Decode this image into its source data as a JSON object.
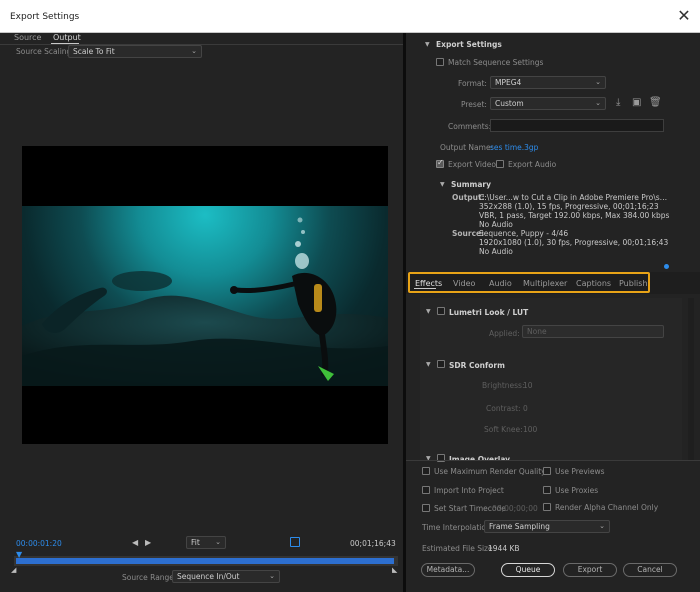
{
  "window": {
    "title": "Export Settings",
    "close_label": "✕"
  },
  "left": {
    "tabs": [
      "Source",
      "Output"
    ],
    "active_tab": "Output",
    "source_scaling_label": "Source Scaling:",
    "source_scaling_value": "Scale To Fit",
    "timecode_start": "00:00:01:20",
    "timecode_end": "00;01;16;43",
    "fit_value": "Fit",
    "source_range_label": "Source Range:",
    "source_range_value": "Sequence In/Out"
  },
  "export": {
    "header": "Export Settings",
    "match_sequence_label": "Match Sequence Settings",
    "format_label": "Format:",
    "format_value": "MPEG4",
    "preset_label": "Preset:",
    "preset_value": "Custom",
    "comments_label": "Comments:",
    "output_name_label": "Output Name:",
    "output_name_value": "ses time.3gp",
    "export_video_label": "Export Video",
    "export_audio_label": "Export Audio",
    "summary_header": "Summary",
    "output_label": "Output:",
    "output_lines": [
      "C:\\User...w to Cut a Clip in Adobe Premiere Pro\\ses time.3gp",
      "352x288 (1.0), 15 fps, Progressive, 00;01;16;23",
      "VBR, 1 pass, Target 192.00 kbps, Max 384.00 kbps",
      "No Audio"
    ],
    "source_label": "Source:",
    "source_lines": [
      "Sequence, Puppy - 4/46",
      "1920x1080 (1.0), 30 fps, Progressive, 00;01;16;43",
      "No Audio"
    ]
  },
  "tabs": {
    "items": [
      "Effects",
      "Video",
      "Audio",
      "Multiplexer",
      "Captions",
      "Publish"
    ],
    "active": "Effects",
    "highlight_color": "#e8a317"
  },
  "effects": {
    "lumetri_header": "Lumetri Look / LUT",
    "applied_label": "Applied:",
    "applied_value": "None",
    "sdr_header": "SDR Conform",
    "brightness_label": "Brightness:",
    "brightness_value": "10",
    "contrast_label": "Contrast:",
    "contrast_value": "0",
    "soft_knee_label": "Soft Knee:",
    "soft_knee_value": "100",
    "image_overlay_header": "Image Overlay"
  },
  "bottom": {
    "max_render_label": "Use Maximum Render Quality",
    "use_previews_label": "Use Previews",
    "import_project_label": "Import Into Project",
    "use_proxies_label": "Use Proxies",
    "set_start_tc_label": "Set Start Timecode",
    "start_tc_value": "00;00;00;00",
    "render_alpha_label": "Render Alpha Channel Only",
    "time_interp_label": "Time Interpolation:",
    "time_interp_value": "Frame Sampling",
    "file_size_label": "Estimated File Size:",
    "file_size_value": "1944 KB",
    "buttons": {
      "metadata": "Metadata...",
      "queue": "Queue",
      "export": "Export",
      "cancel": "Cancel"
    }
  },
  "colors": {
    "accent_blue": "#2d8ceb",
    "highlight": "#e8a317",
    "background": "#232323"
  }
}
